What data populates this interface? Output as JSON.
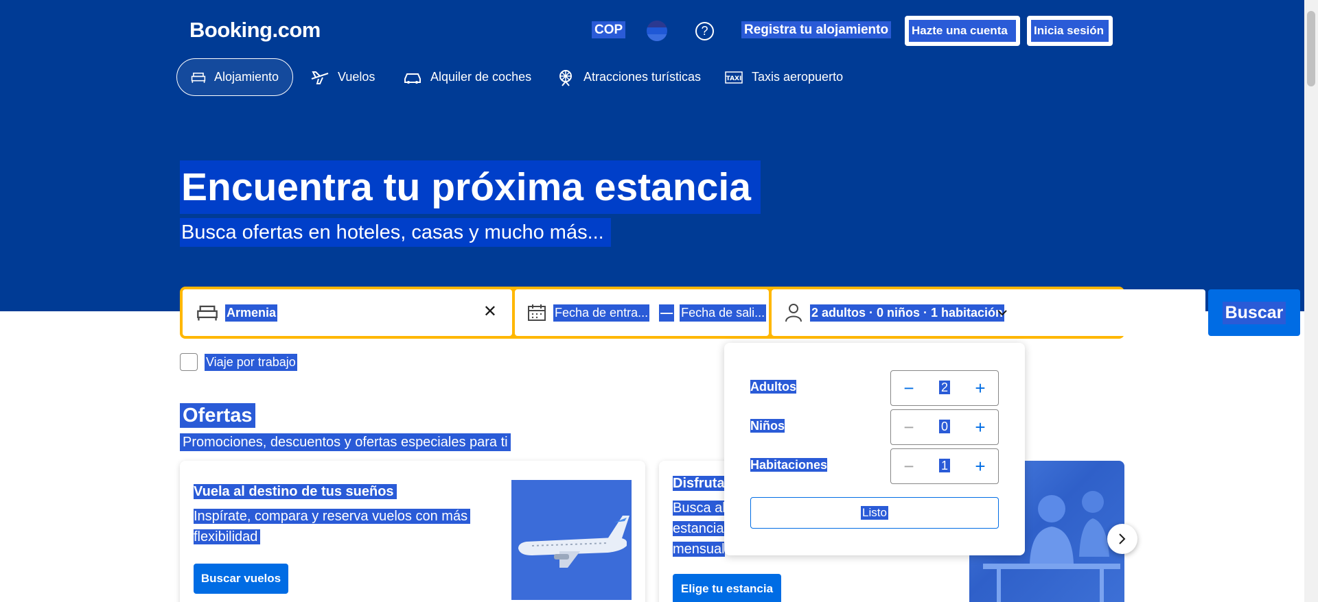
{
  "header": {
    "logo": "Booking.com",
    "currency": "COP",
    "help_symbol": "?",
    "list_property": "Registra tu alojamiento",
    "register": "Hazte una cuenta",
    "signin": "Inicia sesión"
  },
  "nav": {
    "tabs": [
      {
        "label": "Alojamiento",
        "icon": "bed-icon",
        "active": true
      },
      {
        "label": "Vuelos",
        "icon": "plane-icon"
      },
      {
        "label": "Alquiler de coches",
        "icon": "car-icon"
      },
      {
        "label": "Atracciones turísticas",
        "icon": "attractions-icon"
      },
      {
        "label": "Taxis aeropuerto",
        "icon": "taxi-icon"
      }
    ]
  },
  "hero": {
    "title": "Encuentra tu próxima estancia",
    "subtitle": "Busca ofertas en hoteles, casas y mucho más..."
  },
  "search": {
    "destination": "Armenia",
    "checkin": "Fecha de entra...",
    "separator": "—",
    "checkout": "Fecha de sali...",
    "guests": "2 adultos · 0 niños · 1 habitación",
    "button": "Buscar",
    "work_trip": "Viaje por trabajo"
  },
  "guests_popup": {
    "rows": [
      {
        "label": "Adultos",
        "value": "2",
        "minus_enabled": true
      },
      {
        "label": "Niños",
        "value": "0",
        "minus_enabled": false
      },
      {
        "label": "Habitaciones",
        "value": "1",
        "minus_enabled": false
      }
    ],
    "done": "Listo"
  },
  "offers": {
    "title": "Ofertas",
    "subtitle": "Promociones, descuentos y ofertas especiales para ti",
    "card1": {
      "title": "Vuela al destino de tus sueños",
      "line1": "Inspírate, compara y reserva vuelos con más",
      "line2": "flexibilidad",
      "button": "Buscar vuelos"
    },
    "card2": {
      "title": "Disfruta",
      "line1": "Busca alo",
      "line2": "estancias",
      "line3": "mensual",
      "button": "Elige tu estancia"
    }
  },
  "colors": {
    "brand_blue": "#003b95",
    "accent_yellow": "#ffb700",
    "action_blue": "#006ce4",
    "selection": "#2a5bd7"
  }
}
